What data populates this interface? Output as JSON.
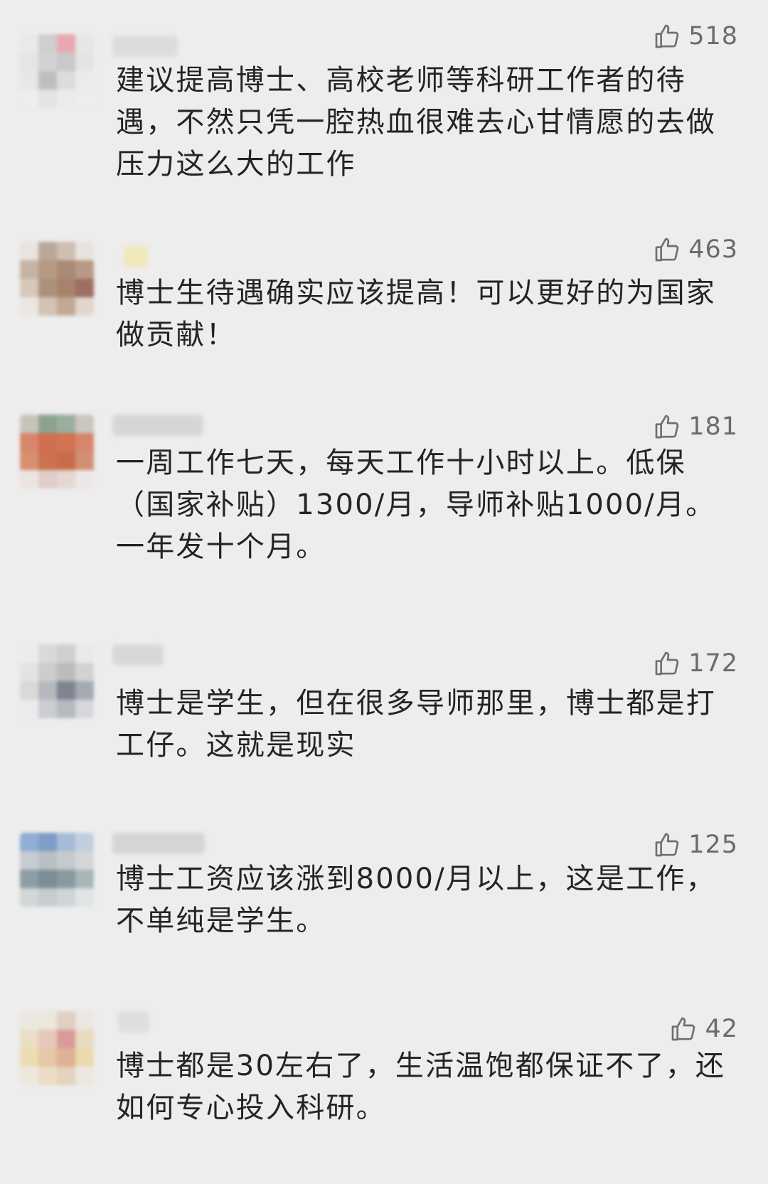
{
  "comments": [
    {
      "likes": "518",
      "text": "建议提高博士、高校老师等科研工作者的待遇，不然只凭一腔热血很难去心甘情愿的去做压力这么大的工作"
    },
    {
      "likes": "463",
      "text": "博士生待遇确实应该提高！可以更好的为国家做贡献！"
    },
    {
      "likes": "181",
      "text": "一周工作七天，每天工作十小时以上。低保（国家补贴）1300/月，导师补贴1000/月。一年发十个月。"
    },
    {
      "likes": "172",
      "text": "博士是学生，但在很多导师那里，博士都是打工仔。这就是现实"
    },
    {
      "likes": "125",
      "text": "博士工资应该涨到8000/月以上，这是工作，不单纯是学生。"
    },
    {
      "likes": "42",
      "text": "博士都是30左右了，生活温饱都保证不了，还如何专心投入科研。"
    }
  ],
  "icons": {
    "like": "thumbs-up-icon"
  }
}
